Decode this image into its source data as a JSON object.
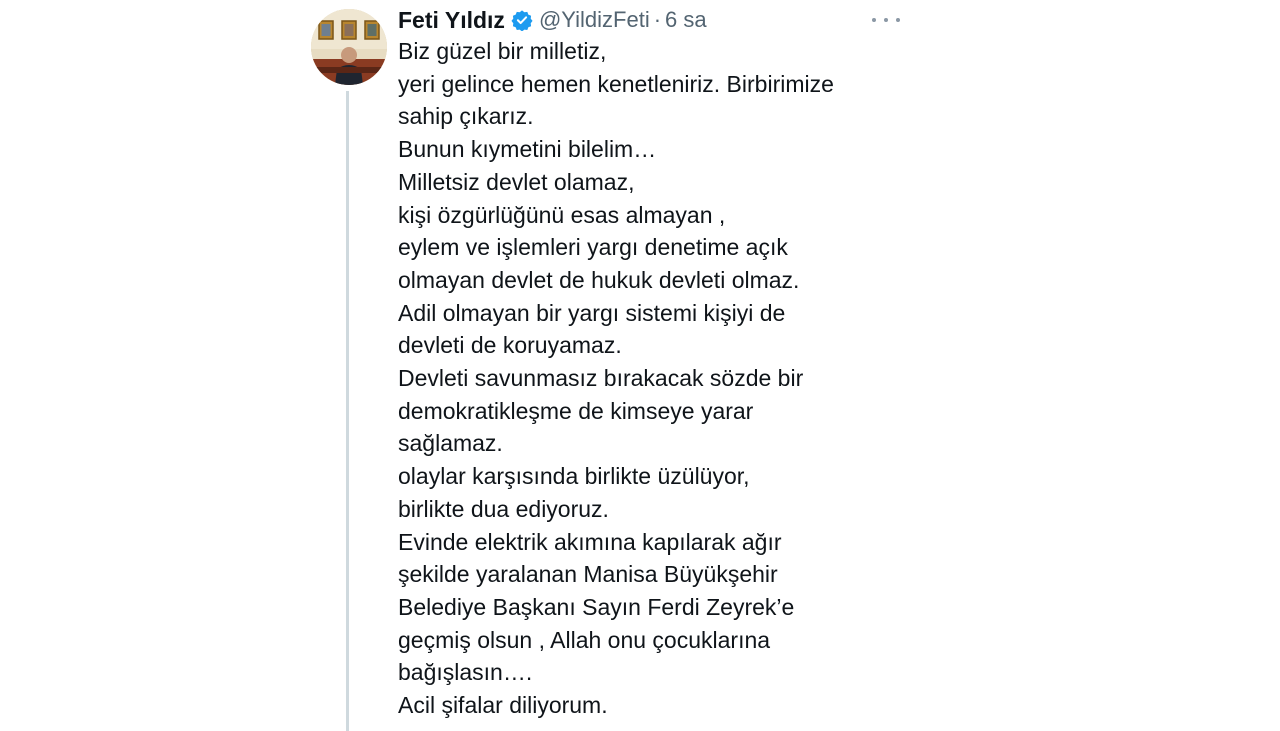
{
  "tweet": {
    "author_name": "Feti Yıldız",
    "handle": "@YildizFeti",
    "separator": "·",
    "time": "6 sa",
    "verified": true,
    "accent_color": "#1d9bf0",
    "lines": [
      "Biz güzel bir milletiz,",
      "yeri gelince hemen kenetleniriz. Birbirimize",
      "sahip çıkarız.",
      "Bunun kıymetini bilelim…",
      "Milletsiz devlet olamaz,",
      "kişi özgürlüğünü esas almayan ,",
      "eylem ve işlemleri yargı denetime açık",
      "olmayan devlet de hukuk devleti olmaz.",
      "Adil olmayan bir yargı sistemi kişiyi de",
      "devleti de koruyamaz.",
      "Devleti savunmasız bırakacak sözde bir",
      "demokratikleşme de kimseye yarar",
      "sağlamaz.",
      "olaylar karşısında birlikte üzülüyor,",
      "birlikte dua ediyoruz.",
      "Evinde elektrik akımına kapılarak ağır",
      "şekilde yaralanan Manisa Büyükşehir",
      "Belediye Başkanı Sayın Ferdi Zeyrek’e",
      "geçmiş olsun , Allah onu çocuklarına",
      "bağışlasın….",
      "Acil şifalar diliyorum."
    ]
  },
  "icons": {
    "verified": "verified-badge-icon",
    "more": "more-options-icon"
  }
}
